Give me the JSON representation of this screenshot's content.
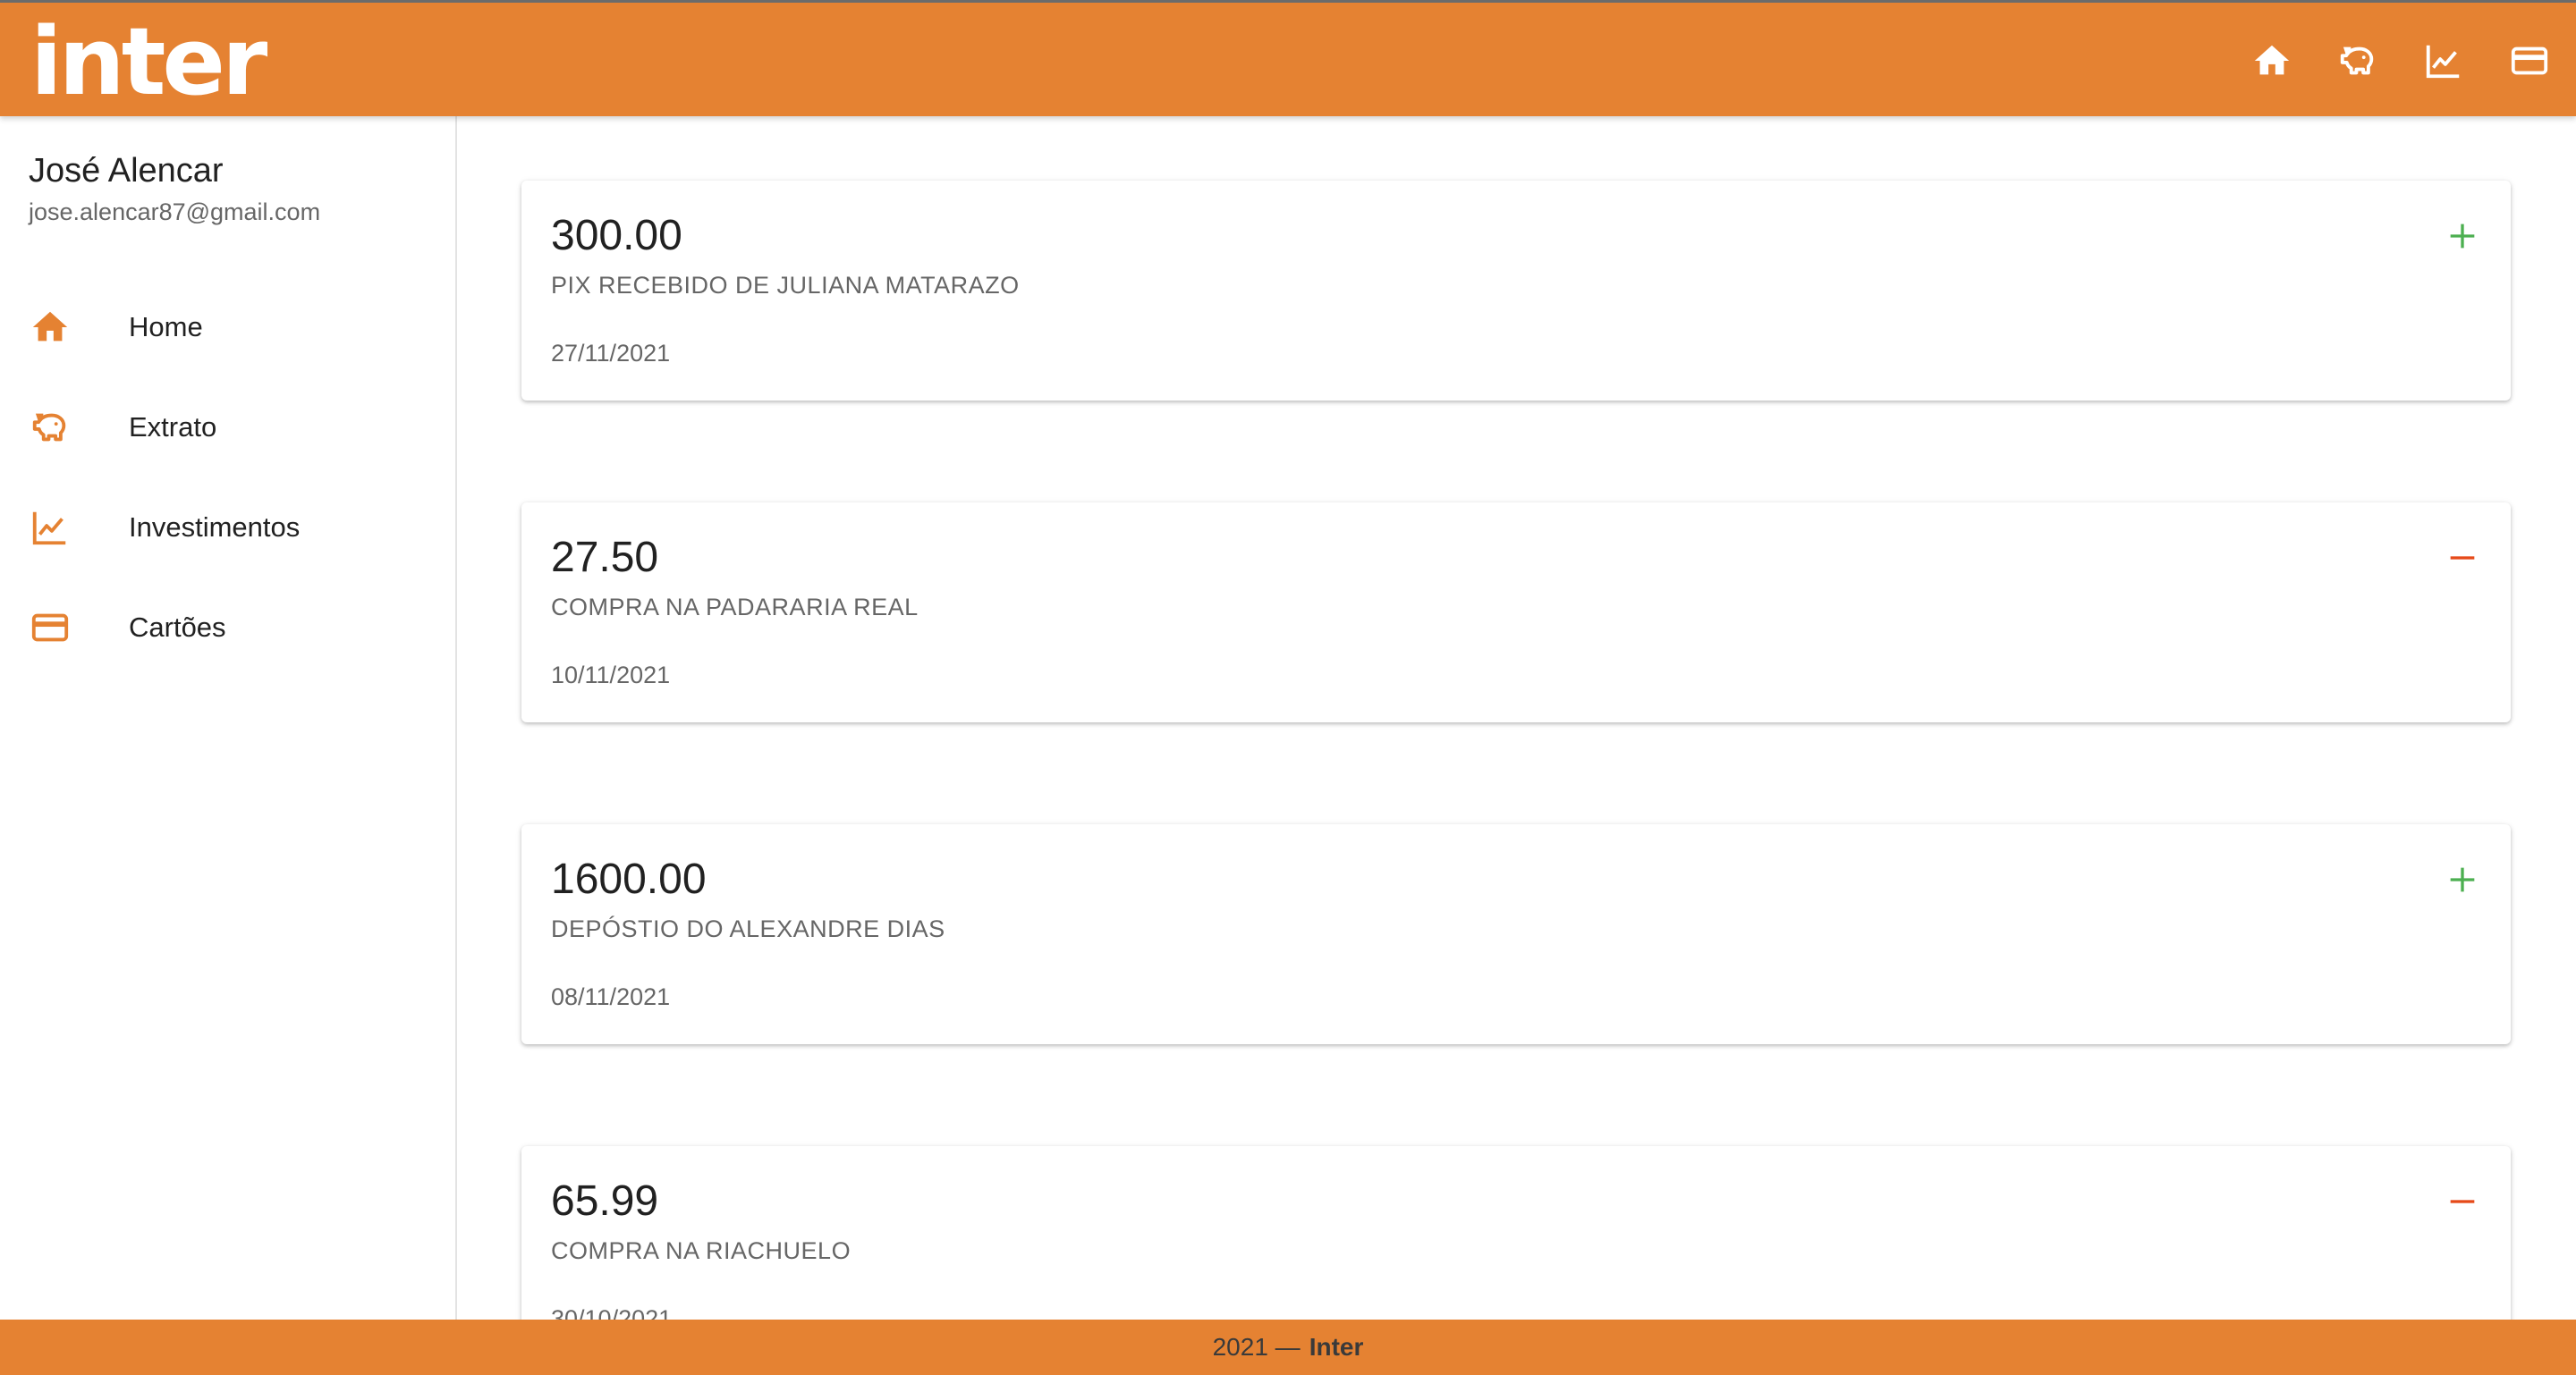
{
  "app": {
    "logo": "inter",
    "brand_color": "#E58232"
  },
  "topbar": {
    "icons": [
      "home-icon",
      "piggy-bank-icon",
      "chart-line-icon",
      "credit-card-icon"
    ]
  },
  "user": {
    "name": "José Alencar",
    "email": "jose.alencar87@gmail.com"
  },
  "sidebar": {
    "items": [
      {
        "label": "Home",
        "icon": "home-icon"
      },
      {
        "label": "Extrato",
        "icon": "piggy-bank-icon"
      },
      {
        "label": "Investimentos",
        "icon": "chart-line-icon"
      },
      {
        "label": "Cartões",
        "icon": "credit-card-icon"
      }
    ]
  },
  "transactions": [
    {
      "amount": "300.00",
      "description": "PIX RECEBIDO DE JULIANA MATARAZO",
      "date": "27/11/2021",
      "type": "credit",
      "color": "#4CAF50"
    },
    {
      "amount": "27.50",
      "description": "COMPRA NA PADARARIA REAL",
      "date": "10/11/2021",
      "type": "debit",
      "color": "#E64A19"
    },
    {
      "amount": "1600.00",
      "description": "DEPÓSTIO DO ALEXANDRE DIAS",
      "date": "08/11/2021",
      "type": "credit",
      "color": "#4CAF50"
    },
    {
      "amount": "65.99",
      "description": "COMPRA NA RIACHUELO",
      "date": "30/10/2021",
      "type": "debit",
      "color": "#E64A19"
    }
  ],
  "footer": {
    "year": "2021 —",
    "brand": "Inter"
  }
}
